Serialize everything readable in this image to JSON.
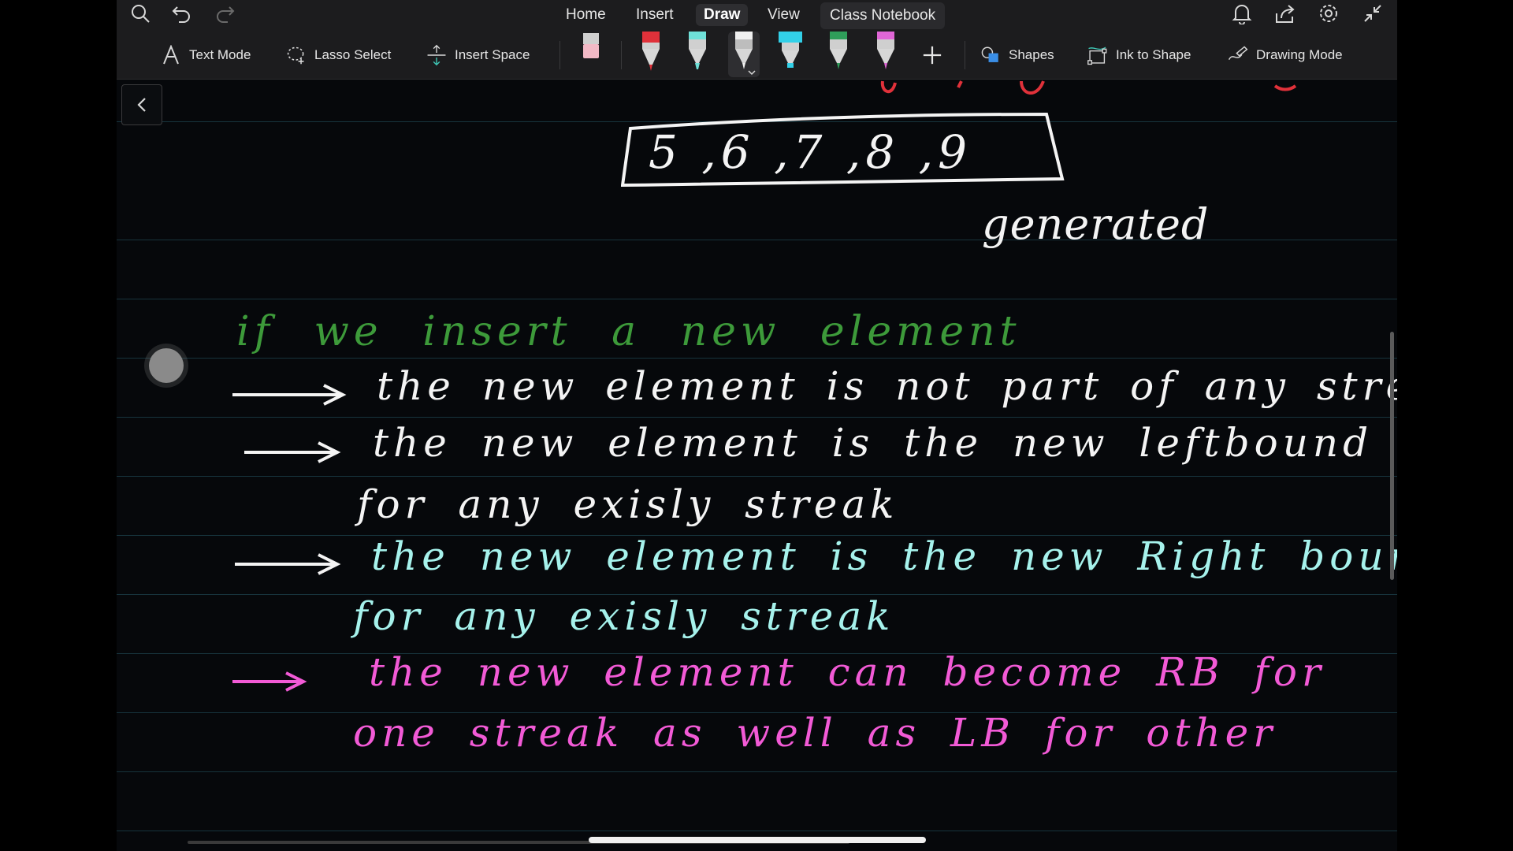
{
  "menu": {
    "tabs": [
      "Home",
      "Insert",
      "Draw",
      "View"
    ],
    "active_tab": "Draw",
    "notebook": "Class Notebook"
  },
  "toolbar": {
    "text_mode": "Text Mode",
    "lasso_select": "Lasso Select",
    "insert_space": "Insert Space",
    "shapes": "Shapes",
    "ink_to_shape": "Ink to Shape",
    "drawing_mode": "Drawing Mode",
    "pen_colors": [
      "#e0313a",
      "#6fe0d8",
      "#f0f0f0",
      "#32d0e8",
      "#2f9e5a",
      "#e066d6"
    ],
    "eraser_color": "#f2b9c6"
  },
  "colors": {
    "ink_white": "#f4f4f4",
    "ink_green": "#3d9a3a",
    "ink_cyan": "#a6f2ec",
    "ink_pink": "#f25ad6",
    "ink_red": "#e0313a"
  },
  "notes": {
    "boxed_sequence": "5 ,6 ,7 ,8 ,9",
    "generated": "generated",
    "heading": "if we insert a new element",
    "point1": "the new element is not part of any streak",
    "point2_line1": "the new element is the new leftbound",
    "point2_line2": "for any exisly streak",
    "point3_line1": "the new element is the new Right boundary",
    "point3_line2": "for any exisly streak",
    "point4_line1": "the new element can become RB for",
    "point4_line2": "one streak as well as LB for other"
  }
}
